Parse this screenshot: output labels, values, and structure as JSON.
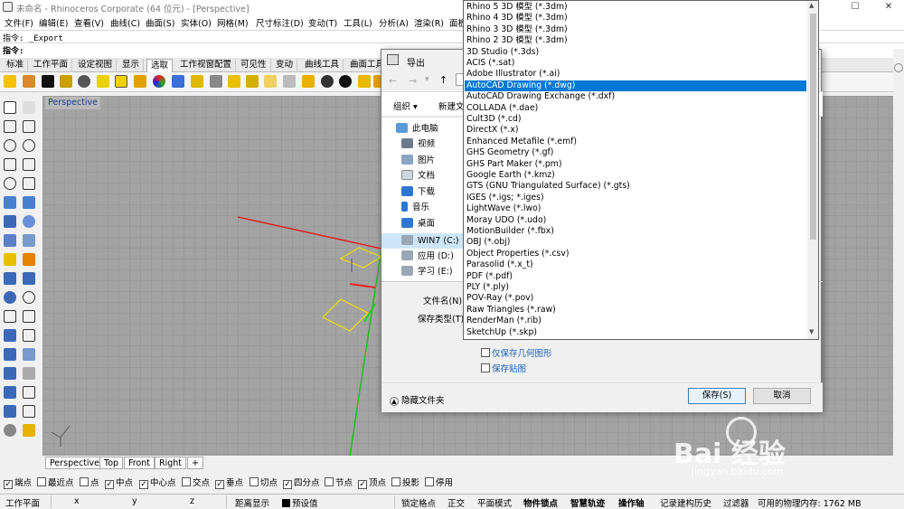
{
  "window": {
    "title": "未命名 - Rhinoceros Corporate (64 位元) - [Perspective]",
    "min": "—",
    "max": "☐",
    "close": "✕"
  },
  "menu": [
    "文件(F)",
    "编辑(E)",
    "查看(V)",
    "曲线(C)",
    "曲面(S)",
    "实体(O)",
    "网格(M)",
    "尺寸标注(D)",
    "变动(T)",
    "工具(L)",
    "分析(A)",
    "渲染(R)",
    "面板"
  ],
  "command": {
    "history": "指令: _Export",
    "prompt": "指令:"
  },
  "toolbar_tabs": [
    "标准",
    "工作平面",
    "设定视图",
    "显示",
    "选取",
    "工作视窗配置",
    "可见性",
    "变动",
    "曲线工具",
    "曲面工具"
  ],
  "active_tab": "选取",
  "viewport": {
    "title": "Perspective",
    "tabs": [
      "Perspective",
      "Top",
      "Front",
      "Right"
    ],
    "add_tab": "+"
  },
  "osnaps": [
    {
      "label": "端点",
      "checked": true
    },
    {
      "label": "最近点",
      "checked": false
    },
    {
      "label": "点",
      "checked": false
    },
    {
      "label": "中点",
      "checked": true
    },
    {
      "label": "中心点",
      "checked": true
    },
    {
      "label": "交点",
      "checked": false
    },
    {
      "label": "垂点",
      "checked": true
    },
    {
      "label": "切点",
      "checked": false
    },
    {
      "label": "四分点",
      "checked": true
    },
    {
      "label": "节点",
      "checked": false
    },
    {
      "label": "顶点",
      "checked": true
    },
    {
      "label": "投影",
      "checked": false
    },
    {
      "label": "停用",
      "checked": false
    }
  ],
  "status": {
    "cplane": "工作平面",
    "x": "x",
    "y": "y",
    "z": "z",
    "distance": "距离显示",
    "default": "预设值",
    "lock_grid": "锁定格点",
    "ortho": "正交",
    "planar": "平面模式",
    "osnap": "物件锁点",
    "smarttrack": "智慧轨迹",
    "gumball": "操作轴",
    "history": "记录建构历史",
    "filter": "过滤器",
    "memory": "可用的物理内存: 1762 MB"
  },
  "dialog": {
    "title": "导出",
    "organize": "组织",
    "new_folder": "新建文",
    "nav": [
      "此电脑",
      "视频",
      "图片",
      "文档",
      "下载",
      "音乐",
      "桌面",
      "WIN7 (C:)",
      "应用 (D:)",
      "学习 (E:)"
    ],
    "filename_label": "文件名(N):",
    "filetype_label": "保存类型(T):",
    "save_geometry": "仅保存几何图形",
    "save_textures": "保存贴图",
    "hide_folders": "隐藏文件夹",
    "save": "保存(S)",
    "cancel": "取消"
  },
  "file_types": [
    "Rhino 5 3D 模型 (*.3dm)",
    "Rhino 4 3D 模型 (*.3dm)",
    "Rhino 3 3D 模型 (*.3dm)",
    "Rhino 2 3D 模型 (*.3dm)",
    "3D Studio (*.3ds)",
    "ACIS (*.sat)",
    "Adobe Illustrator (*.ai)",
    "AutoCAD Drawing (*.dwg)",
    "AutoCAD Drawing Exchange (*.dxf)",
    "COLLADA (*.dae)",
    "Cult3D (*.cd)",
    "DirectX (*.x)",
    "Enhanced Metafile (*.emf)",
    "GHS Geometry (*.gf)",
    "GHS Part Maker (*.pm)",
    "Google Earth (*.kmz)",
    "GTS (GNU Triangulated Surface) (*.gts)",
    "IGES (*.igs; *.iges)",
    "LightWave (*.lwo)",
    "Moray UDO (*.udo)",
    "MotionBuilder (*.fbx)",
    "OBJ (*.obj)",
    "Object Properties (*.csv)",
    "Parasolid (*.x_t)",
    "PDF (*.pdf)",
    "PLY (*.ply)",
    "POV-Ray (*.pov)",
    "Raw Triangles (*.raw)",
    "RenderMan (*.rib)",
    "SketchUp (*.skp)"
  ],
  "selected_file_type": "AutoCAD Drawing (*.dwg)",
  "watermark": {
    "brand": "Bai 经验",
    "url": "jingyan.baidu.com"
  },
  "colors": {
    "accent": "#0078d7",
    "x_axis": "#e02020",
    "y_axis": "#20c020",
    "selection": "#f5e400"
  }
}
